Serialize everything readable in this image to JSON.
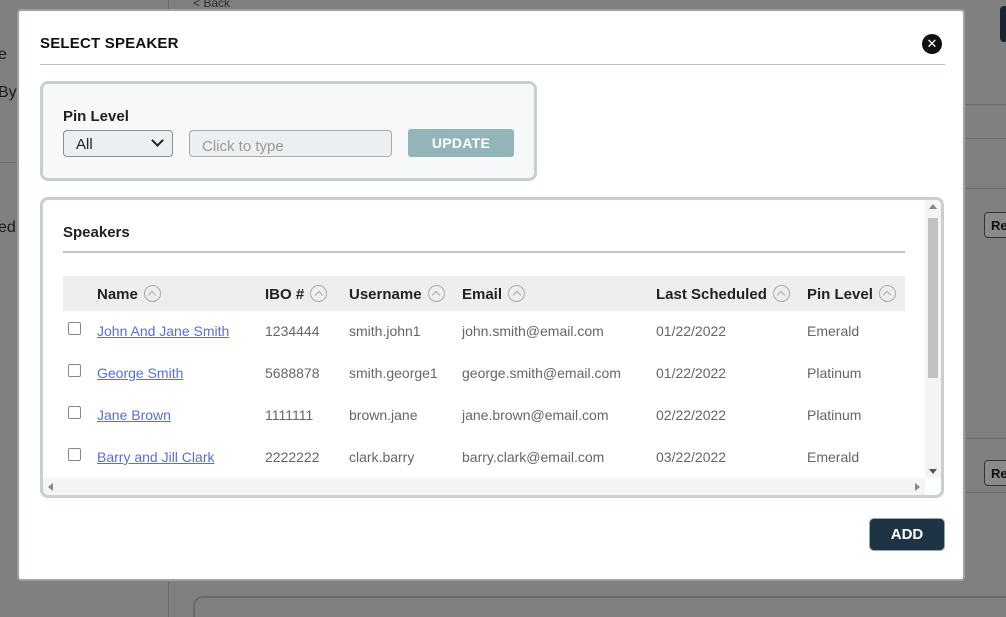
{
  "background": {
    "back_link": "< Back",
    "left_fragments": [
      "e",
      "By",
      "ed"
    ],
    "right_btn_1": "Re",
    "right_btn_2": "Re"
  },
  "modal": {
    "title": "SELECT SPEAKER",
    "close_glyph": "✕"
  },
  "filter": {
    "pin_level_label": "Pin Level",
    "pin_level_selected": "All",
    "search_placeholder": "Click to type",
    "update_label": "UPDATE"
  },
  "speakers": {
    "title": "Speakers",
    "columns": [
      "Name",
      "IBO #",
      "Username",
      "Email",
      "Last Scheduled",
      "Pin Level"
    ],
    "rows": [
      {
        "name": "John And Jane Smith",
        "ibo": "1234444",
        "username": "smith.john1",
        "email": "john.smith@email.com",
        "last_scheduled": "01/22/2022",
        "pin_level": "Emerald"
      },
      {
        "name": "George Smith",
        "ibo": "5688878",
        "username": "smith.george1",
        "email": "george.smith@email.com",
        "last_scheduled": "01/22/2022",
        "pin_level": "Platinum"
      },
      {
        "name": "Jane Brown",
        "ibo": "1111111",
        "username": "brown.jane",
        "email": "jane.brown@email.com",
        "last_scheduled": "02/22/2022",
        "pin_level": "Platinum"
      },
      {
        "name": "Barry and Jill Clark",
        "ibo": "2222222",
        "username": "clark.barry",
        "email": "barry.clark@email.com",
        "last_scheduled": "03/22/2022",
        "pin_level": "Emerald"
      }
    ]
  },
  "actions": {
    "add_label": "ADD"
  },
  "colors": {
    "update_button": "#93b5b9",
    "add_button": "#1e3344",
    "link": "#5a6fd6"
  }
}
